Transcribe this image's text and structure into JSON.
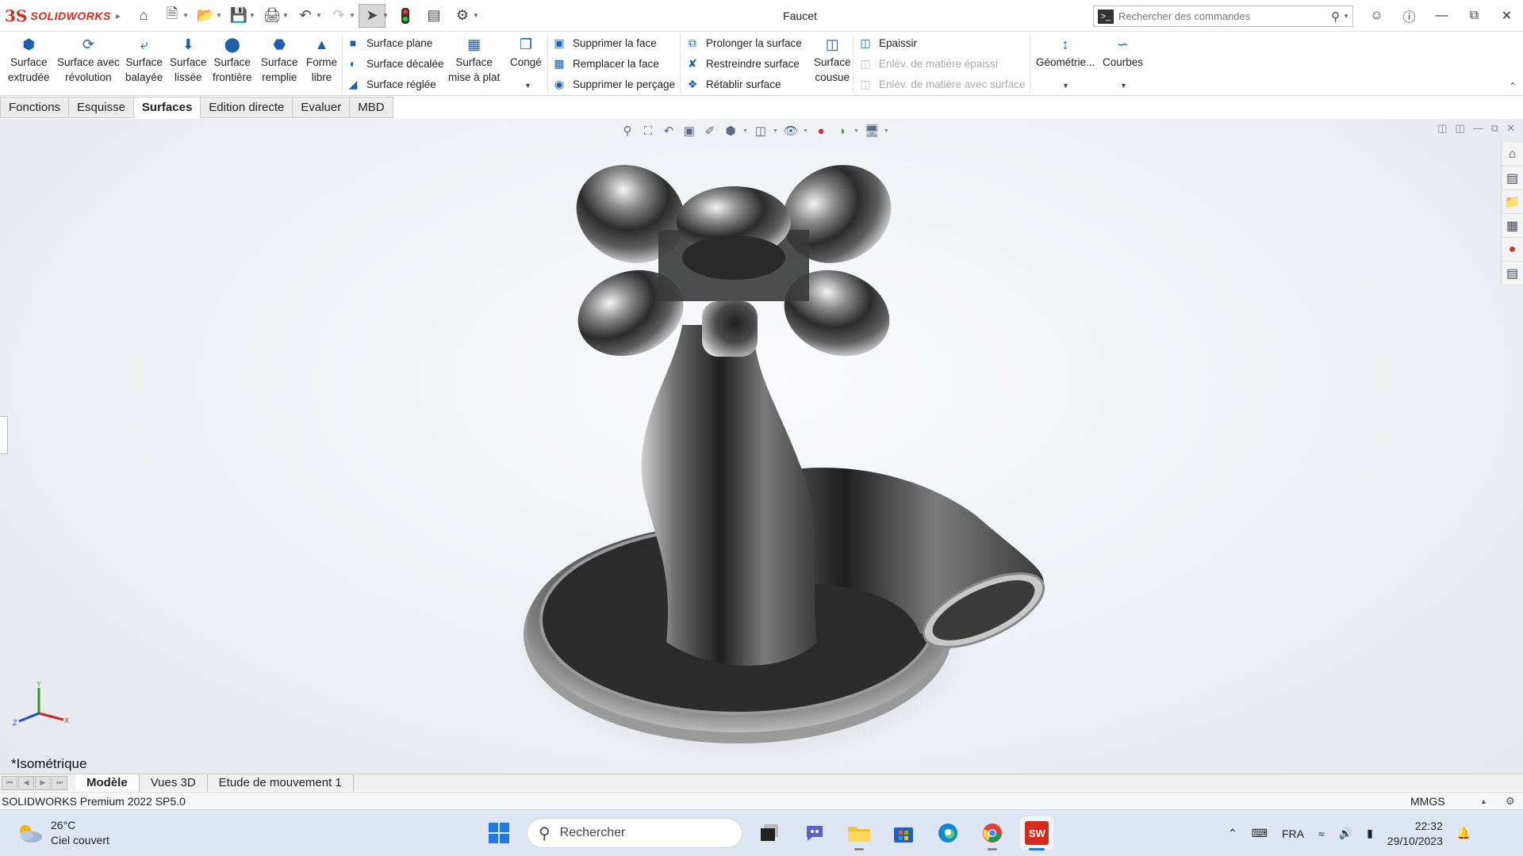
{
  "app": {
    "logo_mark": "3S",
    "logo_text": "SOLIDWORKS",
    "document_title": "Faucet"
  },
  "command_search": {
    "placeholder": "Rechercher des commandes"
  },
  "ribbon": {
    "large_buttons": [
      {
        "line1": "Surface",
        "line2": "extrudée",
        "icon": "extruded-surface-icon"
      },
      {
        "line1": "Surface avec",
        "line2": "révolution",
        "icon": "revolved-surface-icon"
      },
      {
        "line1": "Surface",
        "line2": "balayée",
        "icon": "swept-surface-icon"
      },
      {
        "line1": "Surface",
        "line2": "lissée",
        "icon": "lofted-surface-icon"
      },
      {
        "line1": "Surface",
        "line2": "frontière",
        "icon": "boundary-surface-icon"
      },
      {
        "line1": "Surface",
        "line2": "remplie",
        "icon": "filled-surface-icon"
      },
      {
        "line1": "Forme",
        "line2": "libre",
        "icon": "freeform-icon"
      }
    ],
    "col1": [
      "Surface plane",
      "Surface décalée",
      "Surface réglée"
    ],
    "flatten": {
      "line1": "Surface",
      "line2": "mise à plat"
    },
    "fillet": {
      "label": "Congé"
    },
    "col2": [
      "Supprimer la face",
      "Remplacer la face",
      "Supprimer le perçage"
    ],
    "col3": [
      "Prolonger la surface",
      "Restreindre surface",
      "Rétablir surface"
    ],
    "knit": {
      "line1": "Surface",
      "line2": "cousue"
    },
    "col4": [
      {
        "label": "Epaissir",
        "enabled": true
      },
      {
        "label": "Enlèv. de matière épaissi",
        "enabled": false
      },
      {
        "label": "Enlèv. de matière avec surface",
        "enabled": false
      }
    ],
    "geometry": {
      "label": "Géométrie..."
    },
    "curves": {
      "label": "Courbes"
    }
  },
  "tabs": [
    {
      "label": "Fonctions",
      "active": false
    },
    {
      "label": "Esquisse",
      "active": false
    },
    {
      "label": "Surfaces",
      "active": true
    },
    {
      "label": "Edition directe",
      "active": false
    },
    {
      "label": "Evaluer",
      "active": false
    },
    {
      "label": "MBD",
      "active": false
    }
  ],
  "viewport": {
    "view_name": "*Isométrique",
    "triad": {
      "x": "X",
      "y": "Y",
      "z": "Z"
    }
  },
  "bottom_tabs": [
    {
      "label": "Modèle",
      "active": true
    },
    {
      "label": "Vues 3D",
      "active": false
    },
    {
      "label": "Etude de mouvement 1",
      "active": false
    }
  ],
  "status": {
    "version": "SOLIDWORKS Premium 2022 SP5.0",
    "units": "MMGS"
  },
  "taskbar": {
    "weather_temp": "26°C",
    "weather_desc": "Ciel couvert",
    "search_placeholder": "Rechercher",
    "language": "FRA",
    "time": "22:32",
    "date": "29/10/2023"
  }
}
